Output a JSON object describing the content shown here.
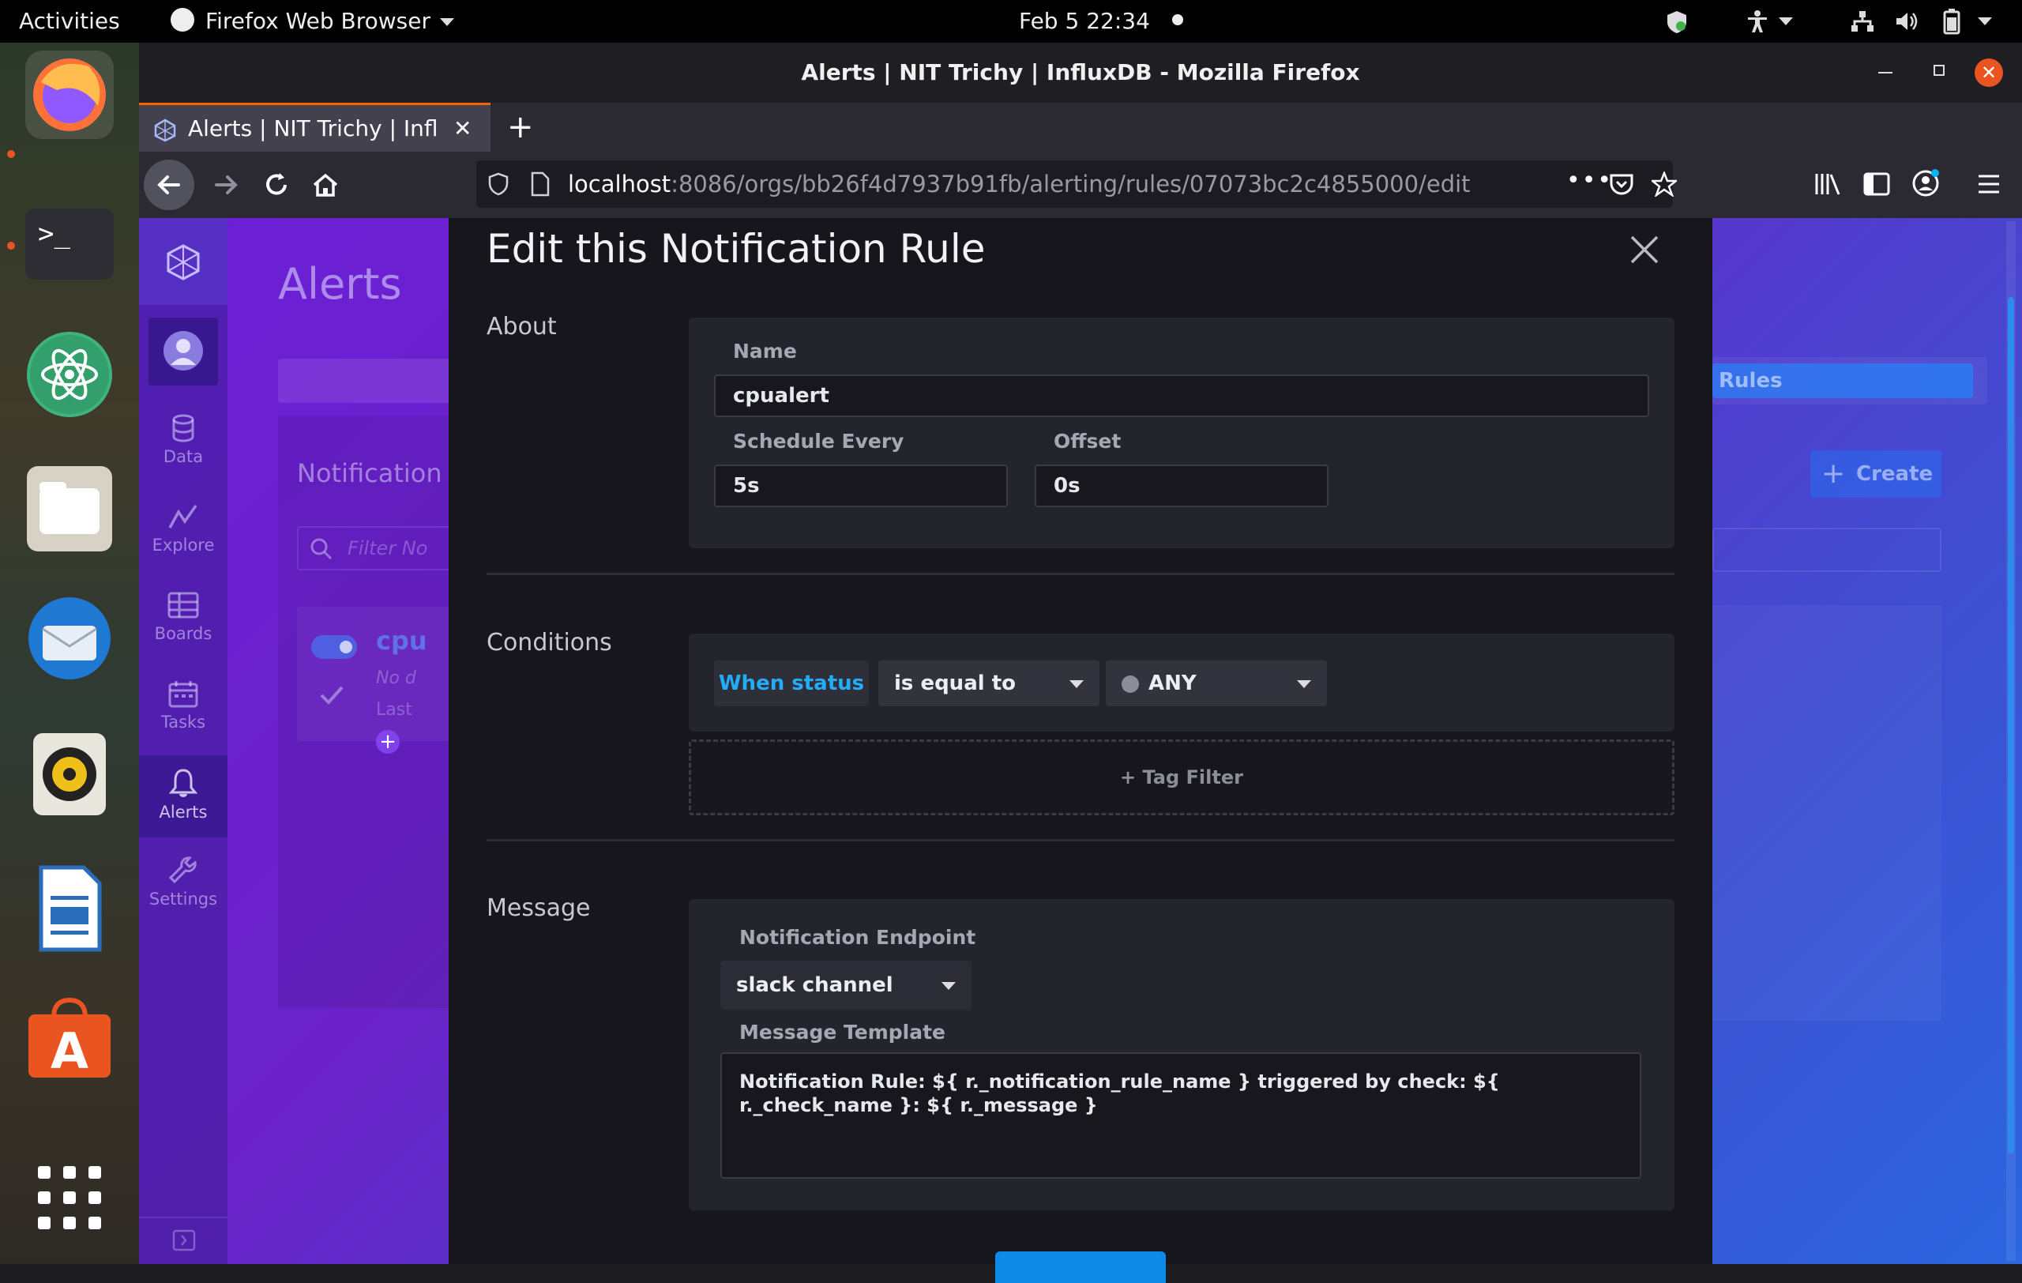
{
  "gnome": {
    "activities": "Activities",
    "app_menu": "Firefox Web Browser",
    "clock": "Feb 5  22:34"
  },
  "dock": {
    "apps": [
      "firefox-icon",
      "terminal-icon",
      "atom-icon",
      "files-icon",
      "thunderbird-icon",
      "rhythmbox-icon",
      "libreoffice-writer-icon",
      "ubuntu-software-icon",
      "app-grid-icon"
    ]
  },
  "browser": {
    "window_title": "Alerts | NIT Trichy | InfluxDB - Mozilla Firefox",
    "tab_title": "Alerts | NIT Trichy | Influx",
    "url_host": "localhost",
    "url_path": ":8086/orgs/bb26f4d7937b91fb/alerting/rules/07073bc2c4855000/edit"
  },
  "influx": {
    "nav": {
      "data": "Data",
      "explore": "Explore",
      "boards": "Boards",
      "tasks": "Tasks",
      "alerts": "Alerts",
      "settings": "Settings"
    },
    "page_title": "Alerts",
    "bg": {
      "notification_header": "Notification",
      "filter_placeholder": "Filter No",
      "rule_name_partial": "cpu",
      "rule_desc_partial": "No d",
      "rule_last_partial": "Last",
      "rules_tab": "Rules",
      "create_button": "Create"
    }
  },
  "dialog": {
    "title": "Edit this Notification Rule",
    "about": {
      "section": "About",
      "name_label": "Name",
      "name_value": "cpualert",
      "schedule_label": "Schedule Every",
      "schedule_value": "5s",
      "offset_label": "Offset",
      "offset_value": "0s"
    },
    "conditions": {
      "section": "Conditions",
      "when_status": "When status",
      "operator": "is equal to",
      "status_value": "ANY",
      "tag_filter": "+ Tag Filter"
    },
    "message": {
      "section": "Message",
      "endpoint_label": "Notification Endpoint",
      "endpoint_value": "slack channel",
      "template_label": "Message Template",
      "template_value": "Notification Rule: ${ r._notification_rule_name } triggered by check: ${ r._check_name }: ${ r._message }"
    }
  },
  "colors": {
    "accent_blue": "#22adf6",
    "primary_button": "#0d8ae8",
    "firefox_tab_accent": "#ff6000",
    "dialog_bg": "#16161c"
  }
}
